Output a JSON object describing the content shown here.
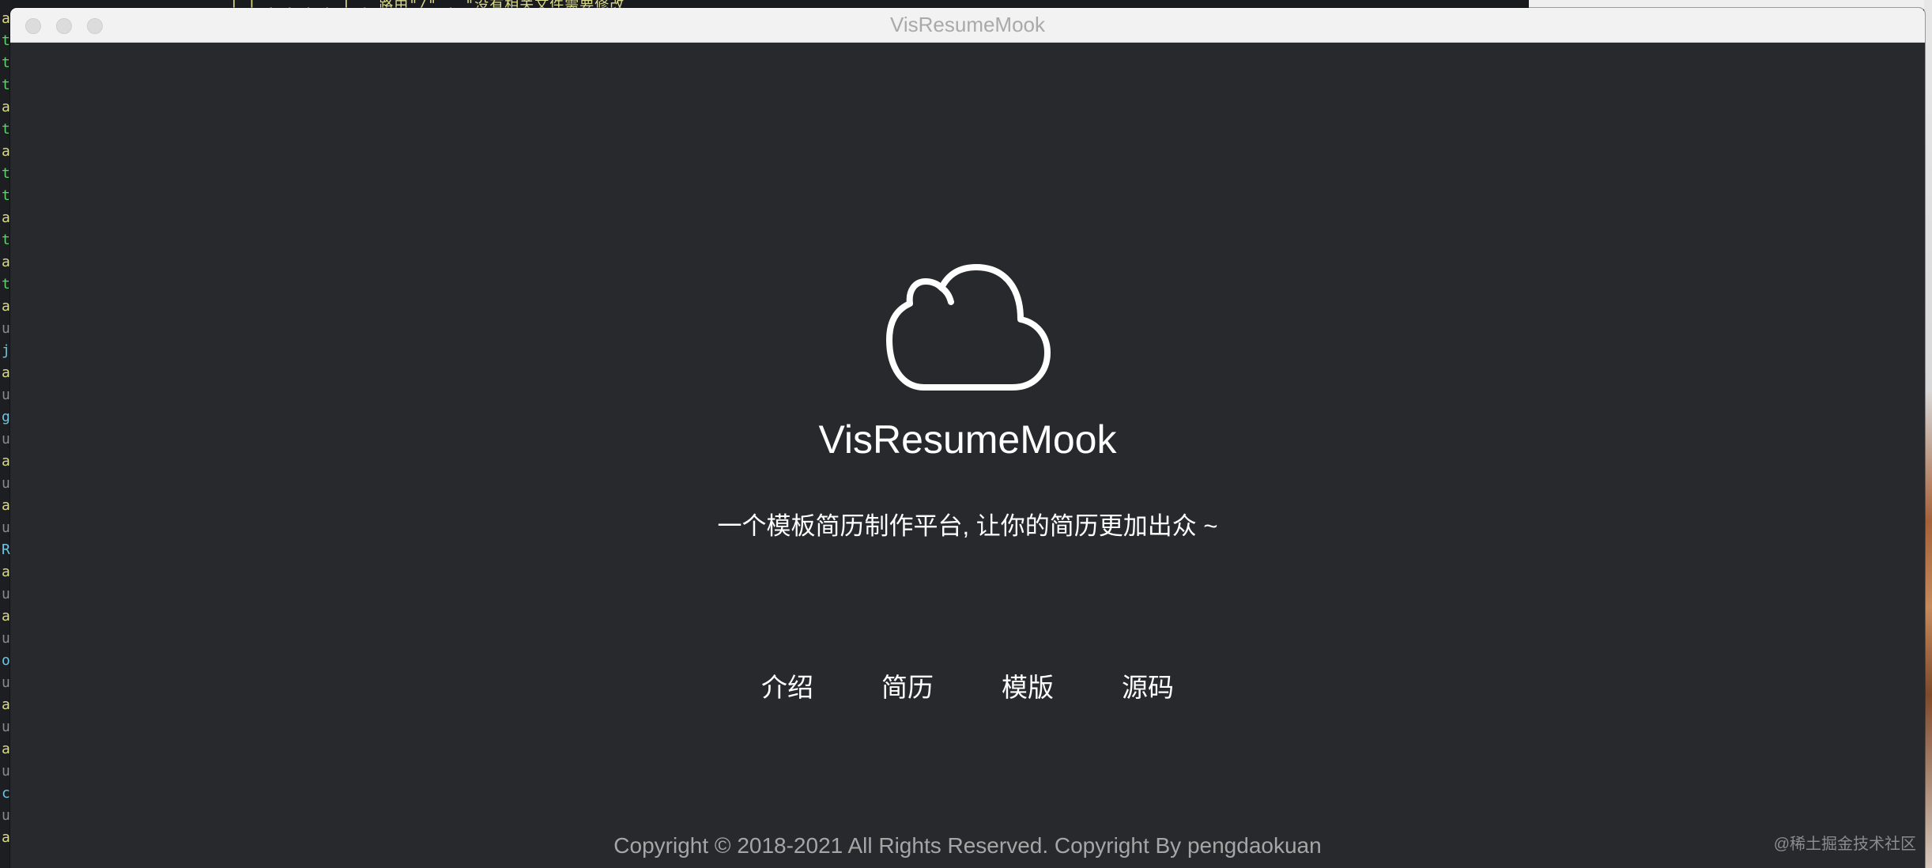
{
  "window": {
    "title": "VisResumeMook"
  },
  "hero": {
    "app_name": "VisResumeMook",
    "tagline": "一个模板简历制作平台, 让你的简历更加出众 ~",
    "logo_icon": "cloud-icon"
  },
  "nav": {
    "items": [
      {
        "label": "介绍"
      },
      {
        "label": "简历"
      },
      {
        "label": "模版"
      },
      {
        "label": "源码"
      }
    ]
  },
  "footer": {
    "copyright": "Copyright © 2018-2021 All Rights Reserved. Copyright By pengdaokuan"
  },
  "watermark": {
    "text": "@稀土掘金技术社区"
  },
  "background": {
    "editor_text": "] [ .  .    .  . ] , 路由\"/\" ,  \"没有相关文件需要修改",
    "editor_gutter": [
      "a",
      "t",
      "t",
      "t",
      "a",
      "t",
      "a",
      "t",
      "t",
      "a",
      "t",
      "a",
      "t",
      "a",
      "u",
      "j",
      "a",
      "u",
      "g",
      "u",
      "a",
      "u",
      "a",
      "u",
      "R",
      "a",
      "u",
      "a",
      "u",
      "o",
      "u",
      "a",
      "u",
      "a",
      "u",
      "c",
      "u",
      "a"
    ]
  },
  "colors": {
    "window_bg": "#28292d",
    "titlebar_bg": "#f2f2f2",
    "text_primary": "#ffffff",
    "text_footer": "#a6a6a6"
  }
}
